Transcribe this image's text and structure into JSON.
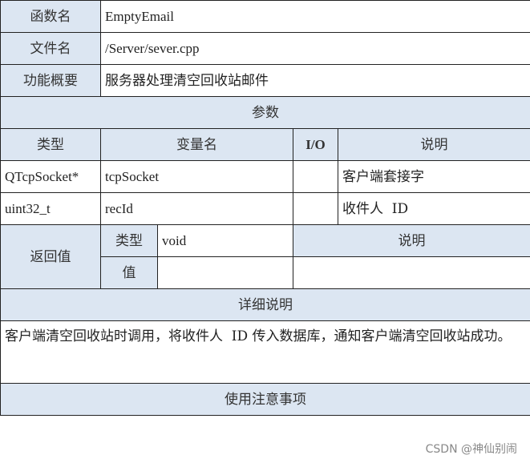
{
  "function_name": {
    "label": "函数名",
    "value": "EmptyEmail"
  },
  "file_name": {
    "label": "文件名",
    "value": "/Server/sever.cpp"
  },
  "summary": {
    "label": "功能概要",
    "value": "服务器处理清空回收站邮件"
  },
  "params": {
    "section_title": "参数",
    "headers": {
      "type": "类型",
      "name": "变量名",
      "io": "I/O",
      "desc": "说明"
    },
    "rows": [
      {
        "type": "QTcpSocket*",
        "name": "tcpSocket",
        "io": "",
        "desc": "客户端套接字"
      },
      {
        "type": "uint32_t",
        "name": "recId",
        "io": "",
        "desc": "收件人  ID"
      }
    ]
  },
  "return": {
    "label": "返回值",
    "type_label": "类型",
    "type_value": "void",
    "value_label": "值",
    "value_value": "",
    "desc_label": "说明",
    "desc_value": ""
  },
  "details": {
    "section_title": "详细说明",
    "text": "客户端清空回收站时调用，将收件人  ID 传入数据库，通知客户端清空回收站成功。"
  },
  "notes": {
    "section_title": "使用注意事项",
    "text": ""
  },
  "watermark": "CSDN @神仙别闹"
}
